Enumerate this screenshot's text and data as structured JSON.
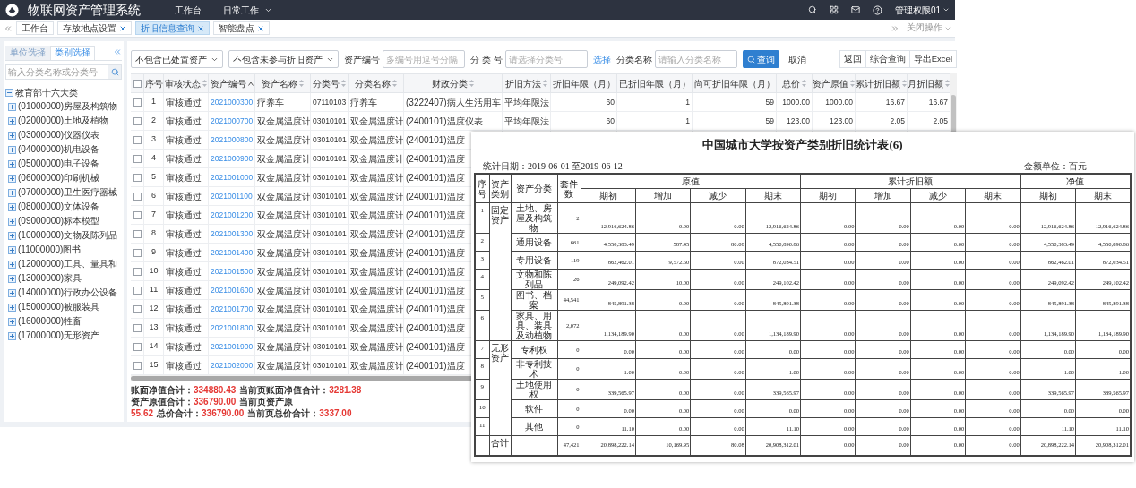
{
  "app": {
    "title": "物联网资产管理系统",
    "nav": [
      {
        "label": "工作台",
        "dropdown": false
      },
      {
        "label": "日常工作",
        "dropdown": true
      }
    ],
    "user": "管理权限01"
  },
  "tabs": [
    {
      "label": "工作台",
      "closable": false,
      "selected": false
    },
    {
      "label": "存放地点设置",
      "closable": true,
      "selected": false
    },
    {
      "label": "折旧信息查询",
      "closable": true,
      "selected": true
    },
    {
      "label": "智能盘点",
      "closable": true,
      "selected": false
    }
  ],
  "tab_actions": "关闭操作",
  "sidebar": {
    "tabs": [
      {
        "label": "单位选择",
        "selected": false
      },
      {
        "label": "类别选择",
        "selected": true
      }
    ],
    "search_placeholder": "输入分类名称或分类号",
    "tree": [
      {
        "label": "教育部十六大类",
        "expanded": true,
        "children": [
          {
            "label": "(01000000)房屋及构筑物",
            "expanded": false
          },
          {
            "label": "(02000000)土地及植物",
            "expanded": false
          },
          {
            "label": "(03000000)仪器仪表",
            "expanded": false
          },
          {
            "label": "(04000000)机电设备",
            "expanded": false
          },
          {
            "label": "(05000000)电子设备",
            "expanded": false
          },
          {
            "label": "(06000000)印刷机械",
            "expanded": false
          },
          {
            "label": "(07000000)卫生医疗器械",
            "expanded": false
          },
          {
            "label": "(08000000)文体设备",
            "expanded": false
          },
          {
            "label": "(09000000)标本模型",
            "expanded": false
          },
          {
            "label": "(10000000)文物及陈列品",
            "expanded": false
          },
          {
            "label": "(11000000)图书",
            "expanded": false
          },
          {
            "label": "(12000000)工具、量具和",
            "expanded": false
          },
          {
            "label": "(13000000)家具",
            "expanded": false
          },
          {
            "label": "(14000000)行政办公设备",
            "expanded": false
          },
          {
            "label": "(15000000)被服装具",
            "expanded": false
          },
          {
            "label": "(16000000)牲畜",
            "expanded": false
          },
          {
            "label": "(17000000)无形资产",
            "expanded": false
          }
        ]
      }
    ]
  },
  "filters": [
    {
      "kind": "select",
      "value": "不包含已处置资产"
    },
    {
      "kind": "select",
      "value": "不包含未参与折旧资产"
    },
    {
      "kind": "input",
      "label": "资产编号",
      "placeholder": "多编号用逗号分隔"
    },
    {
      "kind": "input",
      "label": "分 类 号",
      "placeholder": "请选择分类号"
    },
    {
      "kind": "link",
      "label": "选择"
    },
    {
      "kind": "input",
      "label": "分类名称",
      "placeholder": "请输入分类名称"
    },
    {
      "kind": "primary",
      "label": "查询"
    },
    {
      "kind": "button",
      "label": "取消"
    }
  ],
  "toolbar": [
    "返回",
    "综合查询",
    "导出Excel"
  ],
  "table": {
    "all_checked": false,
    "columns": [
      {
        "label": "序号",
        "kind": "index",
        "sortable": false,
        "sorted_ascending": false
      },
      {
        "label": "审核状态",
        "kind": "text",
        "sortable": true,
        "sorted_ascending": false
      },
      {
        "label": "资产编号",
        "kind": "link",
        "sortable": true,
        "sorted_ascending": true
      },
      {
        "label": "资产名称",
        "kind": "text",
        "sortable": true,
        "sorted_ascending": false
      },
      {
        "label": "分类号",
        "kind": "code",
        "sortable": true,
        "sorted_ascending": false
      },
      {
        "label": "分类名称",
        "kind": "text",
        "sortable": true,
        "sorted_ascending": false
      },
      {
        "label": "财政分类",
        "kind": "text",
        "sortable": true,
        "sorted_ascending": false
      },
      {
        "label": "折旧方法",
        "kind": "text",
        "sortable": true,
        "sorted_ascending": false
      },
      {
        "label": "折旧年限（月）",
        "kind": "number",
        "sortable": false,
        "sorted_ascending": false
      },
      {
        "label": "已折旧年限（月）",
        "kind": "number",
        "sortable": false,
        "sorted_ascending": false
      },
      {
        "label": "尚可折旧年限（月）",
        "kind": "number",
        "sortable": false,
        "sorted_ascending": false
      },
      {
        "label": "总价",
        "kind": "number",
        "sortable": true,
        "sorted_ascending": false
      },
      {
        "label": "资产原值",
        "kind": "number",
        "sortable": true,
        "sorted_ascending": false
      },
      {
        "label": "累计折旧额",
        "kind": "number",
        "sortable": true,
        "sorted_ascending": false
      },
      {
        "label": "月折旧额",
        "kind": "number",
        "sortable": true,
        "sorted_ascending": false
      }
    ],
    "rows": [
      {
        "checked": false,
        "cells": [
          "1",
          "审核通过",
          "2021000300",
          "疗养车",
          "07110103",
          "疗养车",
          "(3222407)病人生活用车",
          "平均年限法",
          "60",
          "1",
          "59",
          "1000.00",
          "1000.00",
          "16.67",
          "16.67"
        ]
      },
      {
        "checked": false,
        "cells": [
          "2",
          "审核通过",
          "2021000700",
          "双金属温度计",
          "03010101",
          "双金属温度计",
          "(2400101)温度仪表",
          "平均年限法",
          "60",
          "1",
          "59",
          "123.00",
          "123.00",
          "2.05",
          "2.05"
        ]
      },
      {
        "checked": false,
        "cells": [
          "3",
          "审核通过",
          "2021000800",
          "双金属温度计",
          "03010101",
          "双金属温度计",
          "(2400101)温度"
        ]
      },
      {
        "checked": false,
        "cells": [
          "4",
          "审核通过",
          "2021000900",
          "双金属温度计",
          "03010101",
          "双金属温度计",
          "(2400101)温度"
        ]
      },
      {
        "checked": false,
        "cells": [
          "5",
          "审核通过",
          "2021001000",
          "双金属温度计",
          "03010101",
          "双金属温度计",
          "(2400101)温度"
        ]
      },
      {
        "checked": false,
        "cells": [
          "6",
          "审核通过",
          "2021001100",
          "双金属温度计",
          "03010101",
          "双金属温度计",
          "(2400101)温度"
        ]
      },
      {
        "checked": false,
        "cells": [
          "7",
          "审核通过",
          "2021001200",
          "双金属温度计",
          "03010101",
          "双金属温度计",
          "(2400101)温度"
        ]
      },
      {
        "checked": false,
        "cells": [
          "8",
          "审核通过",
          "2021001300",
          "双金属温度计",
          "03010101",
          "双金属温度计",
          "(2400101)温度"
        ]
      },
      {
        "checked": false,
        "cells": [
          "9",
          "审核通过",
          "2021001400",
          "双金属温度计",
          "03010101",
          "双金属温度计",
          "(2400101)温度"
        ]
      },
      {
        "checked": false,
        "cells": [
          "10",
          "审核通过",
          "2021001500",
          "双金属温度计",
          "03010101",
          "双金属温度计",
          "(2400101)温度"
        ]
      },
      {
        "checked": false,
        "cells": [
          "11",
          "审核通过",
          "2021001600",
          "双金属温度计",
          "03010101",
          "双金属温度计",
          "(2400101)温度"
        ]
      },
      {
        "checked": false,
        "cells": [
          "12",
          "审核通过",
          "2021001700",
          "双金属温度计",
          "03010101",
          "双金属温度计",
          "(2400101)温度"
        ]
      },
      {
        "checked": false,
        "cells": [
          "13",
          "审核通过",
          "2021001800",
          "双金属温度计",
          "03010101",
          "双金属温度计",
          "(2400101)温度"
        ]
      },
      {
        "checked": false,
        "cells": [
          "14",
          "审核通过",
          "2021001900",
          "双金属温度计",
          "03010101",
          "双金属温度计",
          "(2400101)温度"
        ]
      },
      {
        "checked": false,
        "cells": [
          "15",
          "审核通过",
          "2021002000",
          "双金属温度计",
          "03010101",
          "双金属温度计",
          "(2400101)温度"
        ]
      }
    ]
  },
  "summary": [
    [
      {
        "label": "账面净值合计：",
        "value": "334880.43"
      },
      {
        "label": "当前页账面净值合计：",
        "value": "3281.38"
      },
      {
        "label": "资产原值合计：",
        "value": "336790.00"
      },
      {
        "label": "当前页资产原"
      }
    ],
    [
      {
        "value": "55.62"
      },
      {
        "label": "总价合计：",
        "value": "336790.00"
      },
      {
        "label": "当前页总价合计：",
        "value": "3337.00"
      }
    ]
  ],
  "report": {
    "title": "中国城市大学按资产类别折旧统计表(6)",
    "date_label": "统计日期：2019-06-01 至2019-06-12",
    "unit_label": "金额单位：百元",
    "fixed_columns": [
      "序号",
      "资产类别",
      "资产分类",
      "套件数"
    ],
    "groups": [
      {
        "label": "原值",
        "sub": [
          "期初",
          "增加",
          "减少",
          "期末"
        ]
      },
      {
        "label": "累计折旧额",
        "sub": [
          "期初",
          "增加",
          "减少",
          "期末"
        ]
      },
      {
        "label": "净值",
        "sub": [
          "期初",
          "期末"
        ]
      }
    ],
    "categories": [
      {
        "label": "固定资产",
        "rows": [
          {
            "no": "1",
            "name": "土地、房屋及构筑物",
            "count": "2",
            "values": [
              "12,916,624.86",
              "0.00",
              "0.00",
              "12,916,624.86",
              "0.00",
              "0.00",
              "0.00",
              "0.00",
              "12,916,624.86",
              "12,916,624.86"
            ]
          },
          {
            "no": "2",
            "name": "通用设备",
            "count": "661",
            "values": [
              "4,550,383.49",
              "587.45",
              "80.08",
              "4,550,890.86",
              "0.00",
              "0.00",
              "0.00",
              "0.00",
              "4,550,383.49",
              "4,550,890.86"
            ]
          },
          {
            "no": "3",
            "name": "专用设备",
            "count": "119",
            "values": [
              "862,462.01",
              "9,572.50",
              "0.00",
              "872,034.51",
              "0.00",
              "0.00",
              "0.00",
              "0.00",
              "862,462.01",
              "872,034.51"
            ]
          },
          {
            "no": "4",
            "name": "文物和陈列品",
            "count": "26",
            "values": [
              "249,092.42",
              "10.00",
              "0.00",
              "249,102.42",
              "0.00",
              "0.00",
              "0.00",
              "0.00",
              "249,092.42",
              "249,102.42"
            ]
          },
          {
            "no": "5",
            "name": "图书、档案",
            "count": "44,541",
            "values": [
              "845,891.38",
              "0.00",
              "0.00",
              "845,891.38",
              "0.00",
              "0.00",
              "0.00",
              "0.00",
              "845,891.38",
              "845,891.38"
            ]
          },
          {
            "no": "6",
            "name": "家具、用具、装具及动植物",
            "count": "2,072",
            "values": [
              "1,134,189.90",
              "0.00",
              "0.00",
              "1,134,189.90",
              "0.00",
              "0.00",
              "0.00",
              "0.00",
              "1,134,189.90",
              "1,134,189.90"
            ]
          }
        ]
      },
      {
        "label": "无形资产",
        "rows": [
          {
            "no": "7",
            "name": "专利权",
            "count": "0",
            "values": [
              "0.00",
              "0.00",
              "0.00",
              "0.00",
              "0.00",
              "0.00",
              "0.00",
              "0.00",
              "0.00",
              "0.00"
            ]
          },
          {
            "no": "8",
            "name": "非专利技术",
            "count": "0",
            "values": [
              "1.00",
              "0.00",
              "0.00",
              "1.00",
              "0.00",
              "0.00",
              "0.00",
              "0.00",
              "1.00",
              "1.00"
            ]
          },
          {
            "no": "9",
            "name": "土地使用权",
            "count": "0",
            "values": [
              "339,565.97",
              "0.00",
              "0.00",
              "339,565.97",
              "0.00",
              "0.00",
              "0.00",
              "0.00",
              "339,565.97",
              "339,565.97"
            ]
          },
          {
            "no": "10",
            "name": "软件",
            "count": "0",
            "values": [
              "0.00",
              "0.00",
              "0.00",
              "0.00",
              "0.00",
              "0.00",
              "0.00",
              "0.00",
              "0.00",
              "0.00"
            ]
          },
          {
            "no": "11",
            "name": "其他",
            "count": "0",
            "values": [
              "11.10",
              "0.00",
              "0.00",
              "11.10",
              "0.00",
              "0.00",
              "0.00",
              "0.00",
              "11.10",
              "11.10"
            ]
          }
        ]
      }
    ],
    "total": {
      "label": "合计",
      "count": "47,421",
      "values": [
        "20,898,222.14",
        "10,169.95",
        "80.08",
        "20,908,312.01",
        "0.00",
        "0.00",
        "0.00",
        "0.00",
        "20,898,222.14",
        "20,908,312.01"
      ]
    }
  }
}
